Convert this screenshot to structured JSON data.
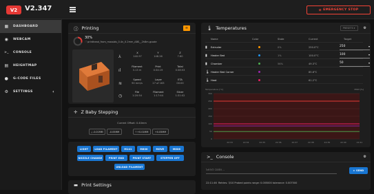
{
  "app": {
    "logo": "V2",
    "version": "V2.347",
    "estop_label": "EMERGENCY STOP"
  },
  "sidebar": {
    "items": [
      {
        "label": "DASHBOARD",
        "icon": "dashboard-icon",
        "glyph": "▦"
      },
      {
        "label": "WEBCAM",
        "icon": "webcam-icon",
        "glyph": "◉"
      },
      {
        "label": "CONSOLE",
        "icon": "console-icon",
        "glyph": ">_"
      },
      {
        "label": "HEIGHTMAP",
        "icon": "heightmap-icon",
        "glyph": "▤"
      },
      {
        "label": "G-CODE FILES",
        "icon": "gcode-files-icon",
        "glyph": "●"
      },
      {
        "label": "SETTINGS",
        "icon": "settings-icon",
        "glyph": "⚙",
        "chevron": "‹"
      }
    ]
  },
  "printing": {
    "title": "Printing",
    "progress_percent": "30%",
    "progress_fraction": 0.3,
    "filename": "printhead_from_mossbis_0.4n_0.2mm_ABS__2h8m.gcode",
    "position": {
      "x_label": "X",
      "x": "140.97",
      "y_label": "Y",
      "y": "148.26",
      "z_label": "Z",
      "z": "7.60"
    },
    "filament": {
      "label": "Filament",
      "value": "3.13 m"
    },
    "print": {
      "label": "Print",
      "value": "0:34:19"
    },
    "total": {
      "label": "Total",
      "value": "0:38:53"
    },
    "speed": {
      "label": "Speed",
      "value": "90 mm/s"
    },
    "layer": {
      "label": "Layer",
      "value": "27 of 163"
    },
    "eta": {
      "label": "ETA",
      "value": "00:00"
    },
    "file": {
      "label": "File",
      "value": "1:20:54"
    },
    "filament_est": {
      "label": "Filament",
      "value": "1:17:44"
    },
    "slicer": {
      "label": "Slicer",
      "value": "1:31:02"
    }
  },
  "babystep": {
    "title": "Z Baby Stepping",
    "offset": "Current Offset: 0.40mm",
    "buttons": [
      "-0.01MM",
      "-0.05MM",
      "+0.01MM",
      "+0.05MM"
    ]
  },
  "macros": {
    "row1": [
      "LIGHT",
      "LOAD FILAMENT",
      "M141",
      "M600",
      "MOVE",
      "M606"
    ],
    "row2": [
      "NOZZLE CHANGE",
      "PRINT END",
      "PRINT START",
      "STEPPER OFF"
    ],
    "row3": [
      "UNLOAD FILAMENT"
    ]
  },
  "print_settings": {
    "title": "Print Settings"
  },
  "temperatures": {
    "title": "Temperatures",
    "presets_label": "PRESETS",
    "columns": [
      "Name",
      "Color",
      "State",
      "Current",
      "Target"
    ],
    "rows": [
      {
        "name": "Extruder",
        "icon": "extruder-icon",
        "color": "#ff9800",
        "state": "0%",
        "current": "250.0°C",
        "target": "250"
      },
      {
        "name": "Heater Bed",
        "icon": "heater-bed-icon",
        "color": "#2196f3",
        "state": "1%",
        "current": "100.0°C",
        "target": "100"
      },
      {
        "name": "Chamber",
        "icon": "chamber-icon",
        "color": "#4caf50",
        "state": "56%",
        "current": "49.3°C",
        "target": "50"
      },
      {
        "name": "Heater Bed Corner",
        "icon": "thermometer-icon",
        "color": "#9c27b0",
        "state": "",
        "current": "85.6°C",
        "target": ""
      },
      {
        "name": "Heat",
        "icon": "thermometer-icon",
        "color": "#e91e63",
        "state": "",
        "current": "61.2°C",
        "target": ""
      }
    ],
    "chart_label_left": "Temperature [°C]",
    "chart_label_right": "PWM [%]"
  },
  "chart_data": {
    "type": "line",
    "x": [
      "22:32",
      "22:33",
      "22:34",
      "22:35",
      "22:36",
      "22:37",
      "22:38",
      "22:39",
      "22:40",
      "22:41"
    ],
    "ylim": [
      0,
      300
    ],
    "yticks": [
      "300",
      "250",
      "200",
      "150",
      "100",
      "50",
      "0"
    ],
    "series": [
      {
        "name": "Extruder",
        "color": "#ff9800",
        "values": [
          250,
          250,
          250,
          250,
          250,
          250,
          250,
          250,
          250,
          250
        ]
      },
      {
        "name": "Extruder target",
        "color": "#e53935",
        "values": [
          250,
          250,
          250,
          250,
          250,
          250,
          250,
          250,
          250,
          250
        ]
      },
      {
        "name": "Heater Bed",
        "color": "#2196f3",
        "values": [
          100,
          100,
          100,
          100,
          100,
          100,
          100,
          100,
          100,
          100
        ]
      },
      {
        "name": "Heater Bed target",
        "color": "#e91e63",
        "values": [
          100,
          100,
          100,
          100,
          100,
          100,
          100,
          100,
          100,
          100
        ]
      },
      {
        "name": "Chamber",
        "color": "#4caf50",
        "values": [
          49,
          49,
          49,
          49,
          49,
          49,
          49,
          49,
          49,
          49
        ]
      },
      {
        "name": "Heater Bed Corner",
        "color": "#9c27b0",
        "values": [
          86,
          86,
          86,
          86,
          86,
          86,
          86,
          86,
          86,
          86
        ]
      }
    ]
  },
  "console": {
    "title": "Console",
    "placeholder": "Send code...",
    "send_label": "SEND",
    "log_time": "22:11:46",
    "log_text": "Retries: 3/10 Probed points range: 0.005000 tolerance: 0.007500"
  }
}
